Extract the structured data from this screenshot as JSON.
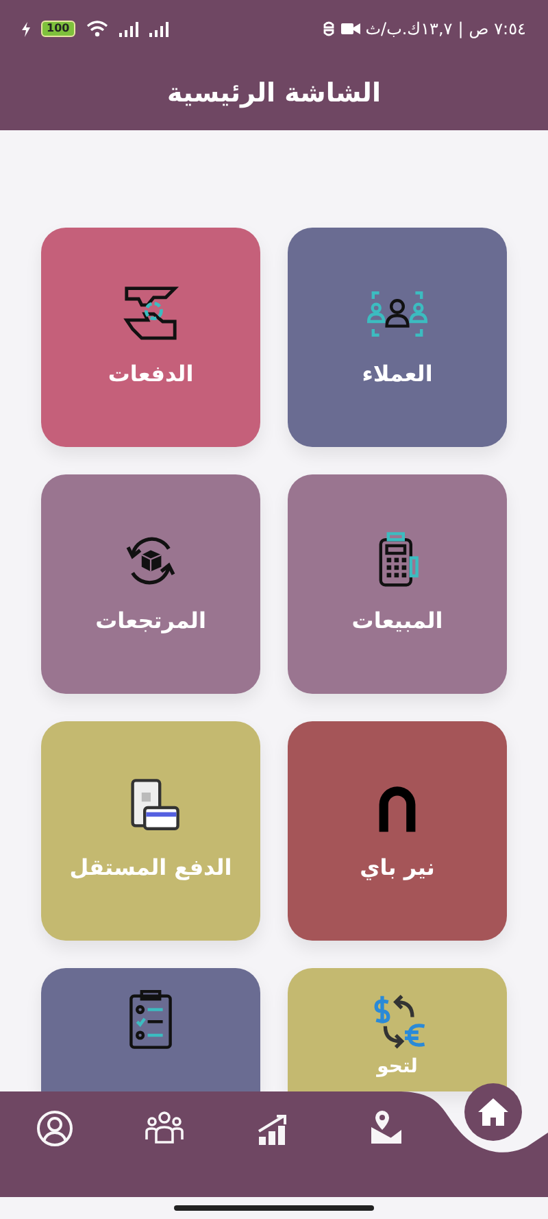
{
  "status_bar": {
    "time": "٧:٥٤ ص",
    "speed": "١٣,٧ك.ب/ث",
    "separator": "|",
    "battery": "100"
  },
  "header": {
    "title": "الشاشة الرئيسية"
  },
  "tiles": [
    {
      "kind": "customers",
      "label": "العملاء",
      "color": "#6a6c92"
    },
    {
      "kind": "payments",
      "label": "الدفعات",
      "color": "#c5607a"
    },
    {
      "kind": "sales",
      "label": "المبيعات",
      "color": "#9a7590"
    },
    {
      "kind": "returns",
      "label": "المرتجعات",
      "color": "#9a7590"
    },
    {
      "kind": "nearpay",
      "label": "نير باي",
      "color": "#a55558"
    },
    {
      "kind": "prepaid",
      "label": "الدفع المستقل",
      "color": "#c4b970"
    },
    {
      "kind": "exchange",
      "label": "لتحو",
      "color": "#c4b970"
    },
    {
      "kind": "checklist",
      "color": "#6a6c92"
    }
  ],
  "bottom_nav": [
    {
      "kind": "home",
      "selected": true
    },
    {
      "kind": "map",
      "selected": false
    },
    {
      "kind": "chart",
      "selected": false
    },
    {
      "kind": "people",
      "selected": false
    },
    {
      "kind": "profile",
      "selected": false
    }
  ]
}
